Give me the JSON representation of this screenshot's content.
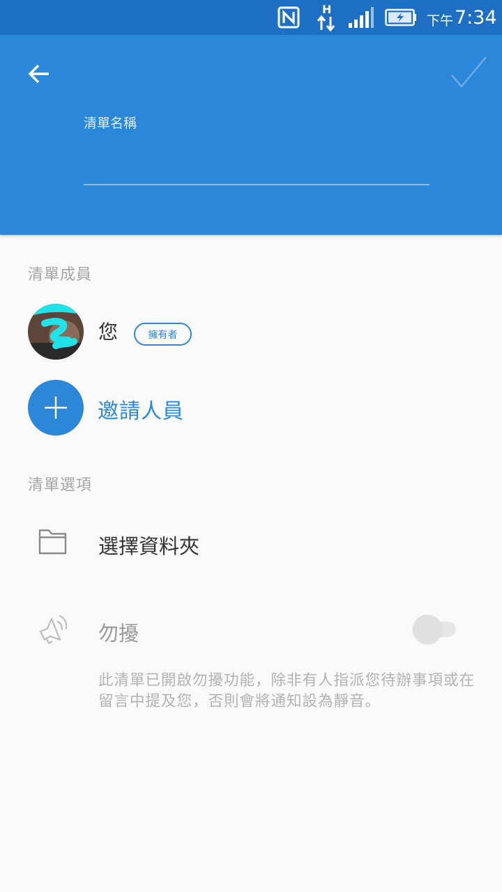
{
  "status_bar": {
    "ampm": "下午",
    "time": "7:34",
    "icons": [
      "nfc-icon",
      "network-h-icon",
      "signal-icon",
      "battery-charging-icon"
    ]
  },
  "header": {
    "back_icon": "arrow-left-icon",
    "confirm_icon": "check-icon",
    "list_name_label": "清單名稱",
    "list_name_value": "",
    "background_color": "#2b87d9"
  },
  "members": {
    "heading": "清單成員",
    "items": [
      {
        "name": "您",
        "role_badge": "擁有者"
      }
    ],
    "invite_label": "邀請人員",
    "invite_icon": "plus-icon"
  },
  "options": {
    "heading": "清單選項",
    "folder": {
      "label": "選擇資料夾",
      "icon": "folder-icon"
    },
    "mute": {
      "label": "勿擾",
      "icon": "megaphone-mute-icon",
      "enabled": false,
      "description": "此清單已開啟勿擾功能，除非有人指派您待辦事項或在留言中提及您，否則會將通知設為靜音。"
    }
  },
  "colors": {
    "accent": "#2b87d9",
    "status_bar": "#1c6fc2",
    "background": "#fafafa"
  }
}
